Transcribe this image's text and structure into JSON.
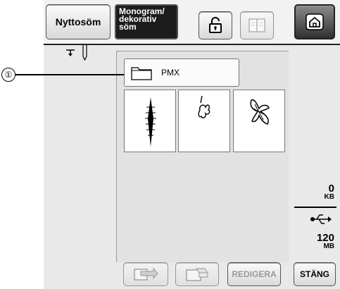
{
  "tabs": {
    "utility": "Nyttosöm",
    "monogram_lines": [
      "Monogram/",
      "dekorativ",
      "söm"
    ]
  },
  "folder": {
    "name": "PMX"
  },
  "memory": {
    "used_value": "0",
    "used_unit": "KB",
    "total_value": "120",
    "total_unit": "MB"
  },
  "buttons": {
    "edit": "REDIGERA",
    "close": "STÄNG"
  },
  "callout": {
    "number": "①"
  },
  "icons": [
    "needle-icon",
    "lock-icon",
    "book-icon",
    "home-icon",
    "folder-icon",
    "usb-icon",
    "retrieve-icon",
    "delete-icon"
  ]
}
